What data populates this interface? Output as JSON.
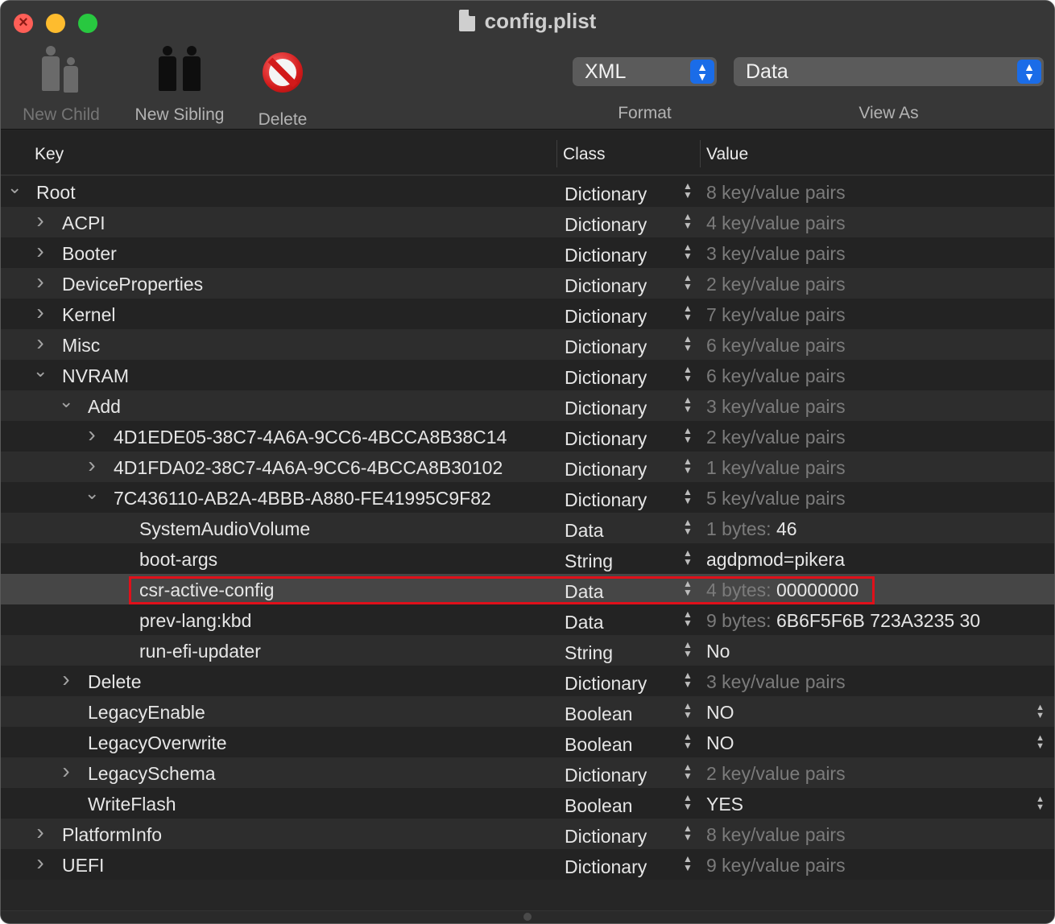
{
  "window": {
    "title": "config.plist"
  },
  "toolbar": {
    "new_child": "New Child",
    "new_sibling": "New Sibling",
    "delete": "Delete",
    "format_value": "XML",
    "format_label": "Format",
    "view_as_value": "Data",
    "view_as_label": "View As"
  },
  "columns": {
    "key": "Key",
    "class": "Class",
    "value": "Value"
  },
  "rows": [
    {
      "key": "Root",
      "cls": "Dictionary",
      "val_muted": "8 key/value pairs",
      "val": ""
    },
    {
      "key": "ACPI",
      "cls": "Dictionary",
      "val_muted": "4 key/value pairs",
      "val": ""
    },
    {
      "key": "Booter",
      "cls": "Dictionary",
      "val_muted": "3 key/value pairs",
      "val": ""
    },
    {
      "key": "DeviceProperties",
      "cls": "Dictionary",
      "val_muted": "2 key/value pairs",
      "val": ""
    },
    {
      "key": "Kernel",
      "cls": "Dictionary",
      "val_muted": "7 key/value pairs",
      "val": ""
    },
    {
      "key": "Misc",
      "cls": "Dictionary",
      "val_muted": "6 key/value pairs",
      "val": ""
    },
    {
      "key": "NVRAM",
      "cls": "Dictionary",
      "val_muted": "6 key/value pairs",
      "val": ""
    },
    {
      "key": "Add",
      "cls": "Dictionary",
      "val_muted": "3 key/value pairs",
      "val": ""
    },
    {
      "key": "4D1EDE05-38C7-4A6A-9CC6-4BCCA8B38C14",
      "cls": "Dictionary",
      "val_muted": "2 key/value pairs",
      "val": ""
    },
    {
      "key": "4D1FDA02-38C7-4A6A-9CC6-4BCCA8B30102",
      "cls": "Dictionary",
      "val_muted": "1 key/value pairs",
      "val": ""
    },
    {
      "key": "7C436110-AB2A-4BBB-A880-FE41995C9F82",
      "cls": "Dictionary",
      "val_muted": "5 key/value pairs",
      "val": ""
    },
    {
      "key": "SystemAudioVolume",
      "cls": "Data",
      "val_muted": "1 bytes: ",
      "val": "46"
    },
    {
      "key": "boot-args",
      "cls": "String",
      "val_muted": "",
      "val": "agdpmod=pikera"
    },
    {
      "key": "csr-active-config",
      "cls": "Data",
      "val_muted": "4 bytes: ",
      "val": "00000000"
    },
    {
      "key": "prev-lang:kbd",
      "cls": "Data",
      "val_muted": "9 bytes: ",
      "val": "6B6F5F6B 723A3235 30"
    },
    {
      "key": "run-efi-updater",
      "cls": "String",
      "val_muted": "",
      "val": "No"
    },
    {
      "key": "Delete",
      "cls": "Dictionary",
      "val_muted": "3 key/value pairs",
      "val": ""
    },
    {
      "key": "LegacyEnable",
      "cls": "Boolean",
      "val_muted": "",
      "val": "NO"
    },
    {
      "key": "LegacyOverwrite",
      "cls": "Boolean",
      "val_muted": "",
      "val": "NO"
    },
    {
      "key": "LegacySchema",
      "cls": "Dictionary",
      "val_muted": "2 key/value pairs",
      "val": ""
    },
    {
      "key": "WriteFlash",
      "cls": "Boolean",
      "val_muted": "",
      "val": "YES"
    },
    {
      "key": "PlatformInfo",
      "cls": "Dictionary",
      "val_muted": "8 key/value pairs",
      "val": ""
    },
    {
      "key": "UEFI",
      "cls": "Dictionary",
      "val_muted": "9 key/value pairs",
      "val": ""
    }
  ],
  "icons": {
    "expanded": "chevron-down-icon",
    "collapsed": "chevron-right-icon",
    "stepper": "up-down-stepper-icon"
  },
  "colors": {
    "highlight_box": "#e0101a",
    "popup_accent": "#1a6ce8",
    "close": "#ff5f57",
    "minimize": "#febc2e",
    "zoom": "#28c840"
  }
}
